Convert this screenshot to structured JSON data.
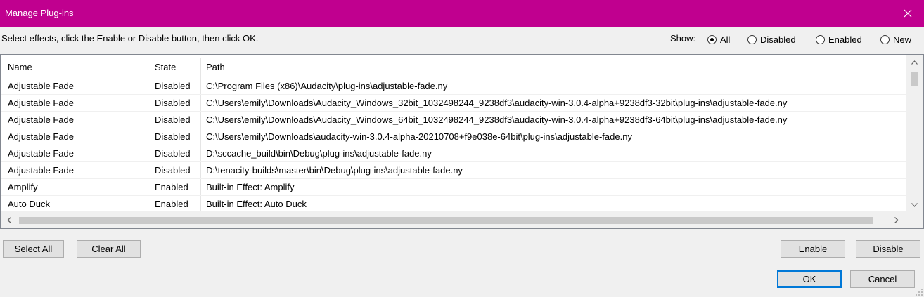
{
  "window": {
    "title": "Manage Plug-ins",
    "close_symbol": "✕"
  },
  "instructions": "Select effects, click the Enable or Disable button, then click OK.",
  "filter": {
    "label": "Show:",
    "options": [
      {
        "label": "All",
        "selected": true
      },
      {
        "label": "Disabled",
        "selected": false
      },
      {
        "label": "Enabled",
        "selected": false
      },
      {
        "label": "New",
        "selected": false
      }
    ]
  },
  "table": {
    "columns": [
      "Name",
      "State",
      "Path"
    ],
    "rows": [
      {
        "name": "Adjustable Fade",
        "state": "Disabled",
        "path": "C:\\Program Files (x86)\\Audacity\\plug-ins\\adjustable-fade.ny"
      },
      {
        "name": "Adjustable Fade",
        "state": "Disabled",
        "path": "C:\\Users\\emily\\Downloads\\Audacity_Windows_32bit_1032498244_9238df3\\audacity-win-3.0.4-alpha+9238df3-32bit\\plug-ins\\adjustable-fade.ny"
      },
      {
        "name": "Adjustable Fade",
        "state": "Disabled",
        "path": "C:\\Users\\emily\\Downloads\\Audacity_Windows_64bit_1032498244_9238df3\\audacity-win-3.0.4-alpha+9238df3-64bit\\plug-ins\\adjustable-fade.ny"
      },
      {
        "name": "Adjustable Fade",
        "state": "Disabled",
        "path": "C:\\Users\\emily\\Downloads\\audacity-win-3.0.4-alpha-20210708+f9e038e-64bit\\plug-ins\\adjustable-fade.ny"
      },
      {
        "name": "Adjustable Fade",
        "state": "Disabled",
        "path": "D:\\sccache_build\\bin\\Debug\\plug-ins\\adjustable-fade.ny"
      },
      {
        "name": "Adjustable Fade",
        "state": "Disabled",
        "path": "D:\\tenacity-builds\\master\\bin\\Debug\\plug-ins\\adjustable-fade.ny"
      },
      {
        "name": "Amplify",
        "state": "Enabled",
        "path": "Built-in Effect: Amplify"
      },
      {
        "name": "Auto Duck",
        "state": "Enabled",
        "path": "Built-in Effect: Auto Duck"
      }
    ]
  },
  "buttons": {
    "select_all": "Select All",
    "clear_all": "Clear All",
    "enable": "Enable",
    "disable": "Disable",
    "ok": "OK",
    "cancel": "Cancel"
  },
  "colors": {
    "titlebar": "#c0008f",
    "default_button_border": "#0078d7"
  },
  "icons": {
    "close": "close-icon",
    "scroll_up": "chevron-up-icon",
    "scroll_down": "chevron-down-icon",
    "scroll_left": "chevron-left-icon",
    "scroll_right": "chevron-right-icon"
  }
}
